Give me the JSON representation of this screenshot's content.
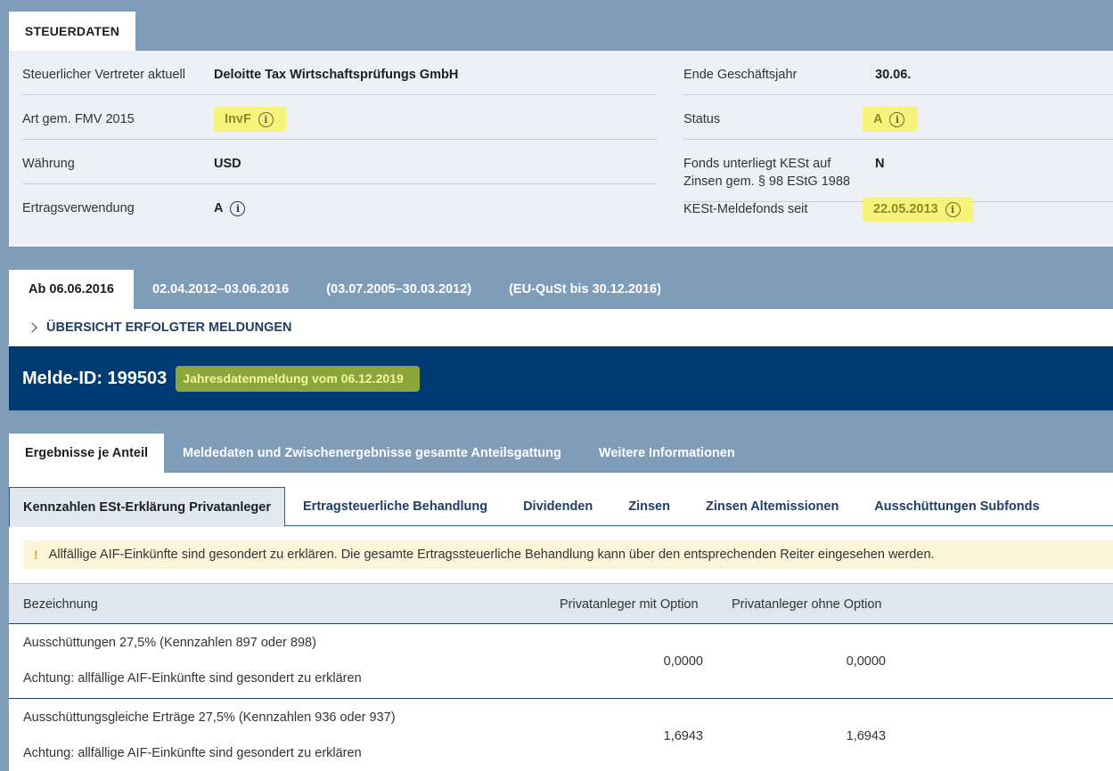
{
  "top_tab": {
    "label": "STEUERDATEN"
  },
  "tax_data": {
    "left": [
      {
        "label": "Steuerlicher Vertreter aktuell",
        "value": "Deloitte Tax Wirtschaftsprüfungs GmbH"
      },
      {
        "label": "Art gem. FMV 2015",
        "value": "InvF"
      },
      {
        "label": "Währung",
        "value": "USD"
      },
      {
        "label": "Ertragsverwendung",
        "value": "A"
      }
    ],
    "right": [
      {
        "label": "Ende Geschäftsjahr",
        "value": "30.06."
      },
      {
        "label": "Status",
        "value": "A"
      },
      {
        "label": "Fonds unterliegt KESt auf Zinsen gem. § 98 EStG 1988",
        "value": "N"
      },
      {
        "label": "KESt-Meldefonds seit",
        "value": "22.05.2013"
      }
    ]
  },
  "period_tabs": [
    "Ab 06.06.2016",
    "02.04.2012–03.06.2016",
    "(03.07.2005–30.03.2012)",
    "(EU-QuSt bis 30.12.2016)"
  ],
  "overview_link": "ÜBERSICHT ERFOLGTER MELDUNGEN",
  "melde": {
    "id_label": "Melde-ID: 199503",
    "badge": "Jahresdatenmeldung vom 06.12.2019"
  },
  "result_tabs": [
    "Ergebnisse je Anteil",
    "Meldedaten und Zwischenergebnisse gesamte Anteilsgattung",
    "Weitere Informationen"
  ],
  "sub_tabs": [
    "Kennzahlen ESt-Erklärung Privatanleger",
    "Ertragsteuerliche Behandlung",
    "Dividenden",
    "Zinsen",
    "Zinsen Altemissionen",
    "Ausschüttungen Subfonds"
  ],
  "notice": {
    "icon": "!",
    "text": "Allfällige AIF-Einkünfte sind gesondert zu erklären. Die gesamte Ertragssteuerliche Behandlung kann über den entsprechenden Reiter eingesehen werden."
  },
  "table": {
    "headers": [
      "Bezeichnung",
      "Privatanleger mit Option",
      "Privatanleger ohne Option"
    ],
    "rows": [
      {
        "title": "Ausschüttungen 27,5% (Kennzahlen 897 oder 898)",
        "note": "Achtung: allfällige AIF-Einkünfte sind gesondert zu erklären",
        "with_option": "0,0000",
        "without_option": "0,0000"
      },
      {
        "title": "Ausschüttungsgleiche Erträge 27,5% (Kennzahlen 936 oder 937)",
        "note": "Achtung: allfällige AIF-Einkünfte sind gesondert zu erklären",
        "with_option": "1,6943",
        "without_option": "1,6943"
      }
    ]
  },
  "colors": {
    "header_bg": "#7f9cb8",
    "panel_bg": "#eceff3",
    "melde_bg": "#003c72",
    "highlight": "#f6f27a",
    "link": "#1f3d66"
  }
}
